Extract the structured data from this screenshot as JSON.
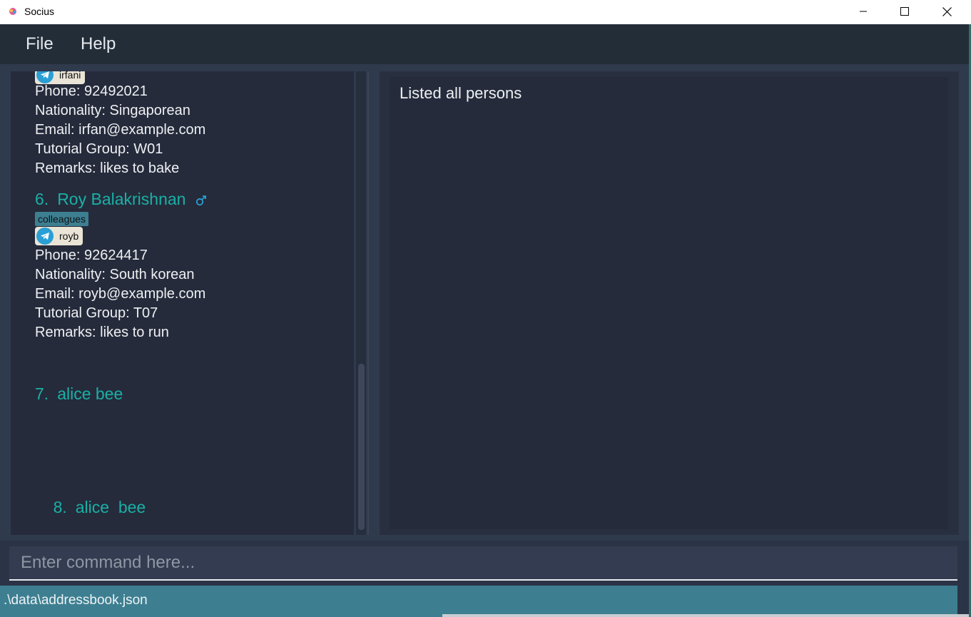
{
  "window": {
    "title": "Socius"
  },
  "menu": {
    "file": "File",
    "help": "Help"
  },
  "persons": [
    {
      "telegram": "irfani",
      "phone": "Phone: 92492021",
      "nationality": "Nationality: Singaporean",
      "email": "Email: irfan@example.com",
      "tutorial": "Tutorial Group: W01",
      "remarks": "Remarks: likes to bake"
    },
    {
      "index": "6.",
      "name": "Roy Balakrishnan",
      "tag": "colleagues",
      "telegram": "royb",
      "phone": "Phone: 92624417",
      "nationality": "Nationality: South korean",
      "email": "Email: royb@example.com",
      "tutorial": "Tutorial Group: T07",
      "remarks": "Remarks: likes to run"
    },
    {
      "index": "7.",
      "name": "alice bee"
    },
    {
      "index": "8.",
      "name": "alice  bee"
    }
  ],
  "result": {
    "text": "Listed all persons"
  },
  "command": {
    "placeholder": "Enter command here..."
  },
  "status": {
    "file_path": ".\\data\\addressbook.json"
  },
  "colors": {
    "accent": "#1ab0a6",
    "tag": "#3d7f91",
    "telegram": "#2a9fd6"
  },
  "icons": {
    "app": "socius-app-icon",
    "telegram": "telegram-icon",
    "gender": "gender-icon"
  }
}
